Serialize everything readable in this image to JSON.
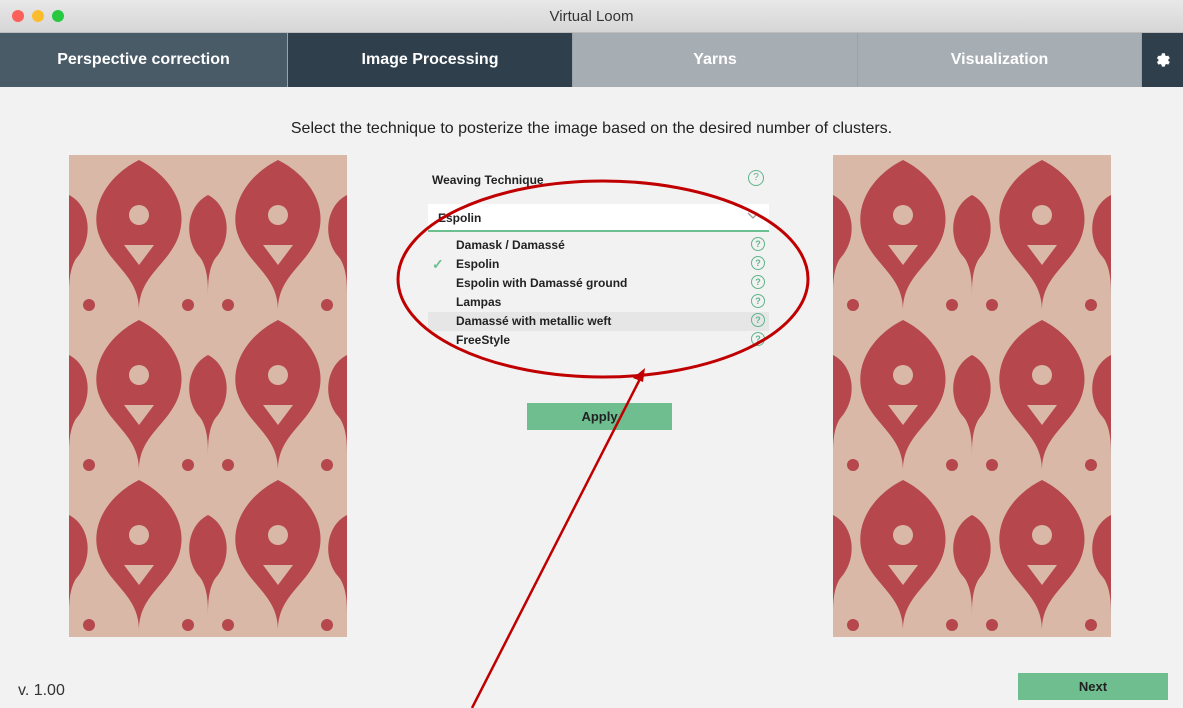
{
  "window": {
    "title": "Virtual Loom"
  },
  "tabs": [
    {
      "label": "Perspective correction",
      "bg": "#4a5b68"
    },
    {
      "label": "Image Processing",
      "bg": "#2f3f4c"
    },
    {
      "label": "Yarns",
      "bg": "#a7aeb3"
    },
    {
      "label": "Visualization",
      "bg": "#a7aeb3"
    }
  ],
  "settings_icon": "gear-icon",
  "instruction": "Select the technique to posterize the image based on the desired number of clusters.",
  "weaving": {
    "label": "Weaving Technique",
    "selected": "Espolin",
    "help_glyph": "?",
    "options": [
      {
        "label": "Damask / Damassé",
        "checked": false
      },
      {
        "label": "Espolin",
        "checked": true
      },
      {
        "label": "Espolin with Damassé ground",
        "checked": false
      },
      {
        "label": "Lampas",
        "checked": false
      },
      {
        "label": "Damassé with metallic weft",
        "checked": false
      },
      {
        "label": "FreeStyle",
        "checked": false
      }
    ]
  },
  "buttons": {
    "apply": "Apply",
    "next": "Next"
  },
  "version": "v. 1.00",
  "colors": {
    "accent": "#6fbe90",
    "annotation": "#c00000",
    "fabric_red": "#b5474d",
    "fabric_bg": "#d9b8a8"
  }
}
